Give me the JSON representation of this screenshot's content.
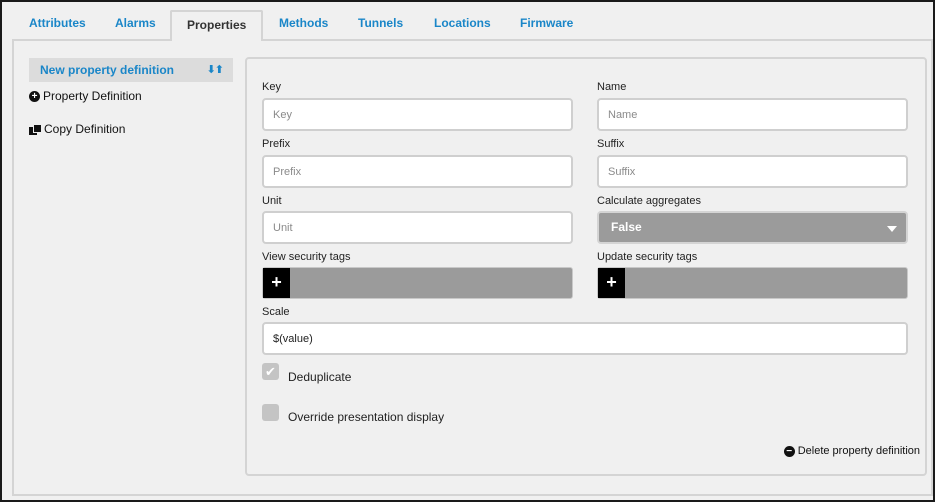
{
  "tabs": [
    {
      "label": "Attributes"
    },
    {
      "label": "Alarms"
    },
    {
      "label": "Properties"
    },
    {
      "label": "Methods"
    },
    {
      "label": "Tunnels"
    },
    {
      "label": "Locations"
    },
    {
      "label": "Firmware"
    }
  ],
  "sidebar": {
    "selected_label": "New property definition",
    "sort_arrows": "⬇⬆",
    "items": [
      {
        "label": "Property Definition",
        "icon": "plus-circle-icon"
      },
      {
        "label": "Copy Definition",
        "icon": "copy-icon"
      }
    ]
  },
  "form": {
    "key": {
      "label": "Key",
      "placeholder": "Key",
      "value": ""
    },
    "name": {
      "label": "Name",
      "placeholder": "Name",
      "value": ""
    },
    "prefix": {
      "label": "Prefix",
      "placeholder": "Prefix",
      "value": ""
    },
    "suffix": {
      "label": "Suffix",
      "placeholder": "Suffix",
      "value": ""
    },
    "unit": {
      "label": "Unit",
      "placeholder": "Unit",
      "value": ""
    },
    "calculate_aggregates": {
      "label": "Calculate aggregates",
      "value": "False"
    },
    "view_security_tags": {
      "label": "View security tags",
      "add": "+"
    },
    "update_security_tags": {
      "label": "Update security tags",
      "add": "+"
    },
    "scale": {
      "label": "Scale",
      "value": "$(value)"
    },
    "deduplicate": {
      "label": "Deduplicate",
      "checked": true,
      "mark": "✔"
    },
    "override_presentation": {
      "label": "Override presentation display",
      "checked": false
    },
    "delete_label": "Delete property definition"
  },
  "colors": {
    "accent": "#1a86c8",
    "panel_bg": "#f0f0f0",
    "select_bg": "#9b9b9b"
  }
}
